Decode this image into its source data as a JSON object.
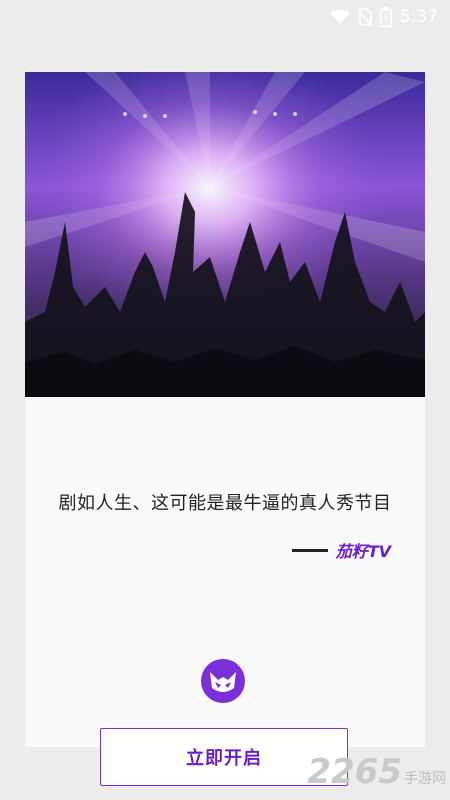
{
  "status_bar": {
    "time": "5:37",
    "icons": [
      "wifi-icon",
      "no-sim-icon",
      "battery-icon"
    ]
  },
  "hero": {
    "image": "concert-crowd-photo"
  },
  "quote": {
    "text": "剧如人生、这可能是最牛逼的真人秀节目"
  },
  "signature": {
    "brand": "茄籽TV"
  },
  "logo": {
    "icon": "app-logo-icon"
  },
  "start_button": {
    "label": "立即开启"
  },
  "watermark": {
    "number": "2265",
    "site": "手游网"
  },
  "colors": {
    "accent": "#6a1fc3",
    "background": "#ececec",
    "card": "#f9f9f9"
  }
}
